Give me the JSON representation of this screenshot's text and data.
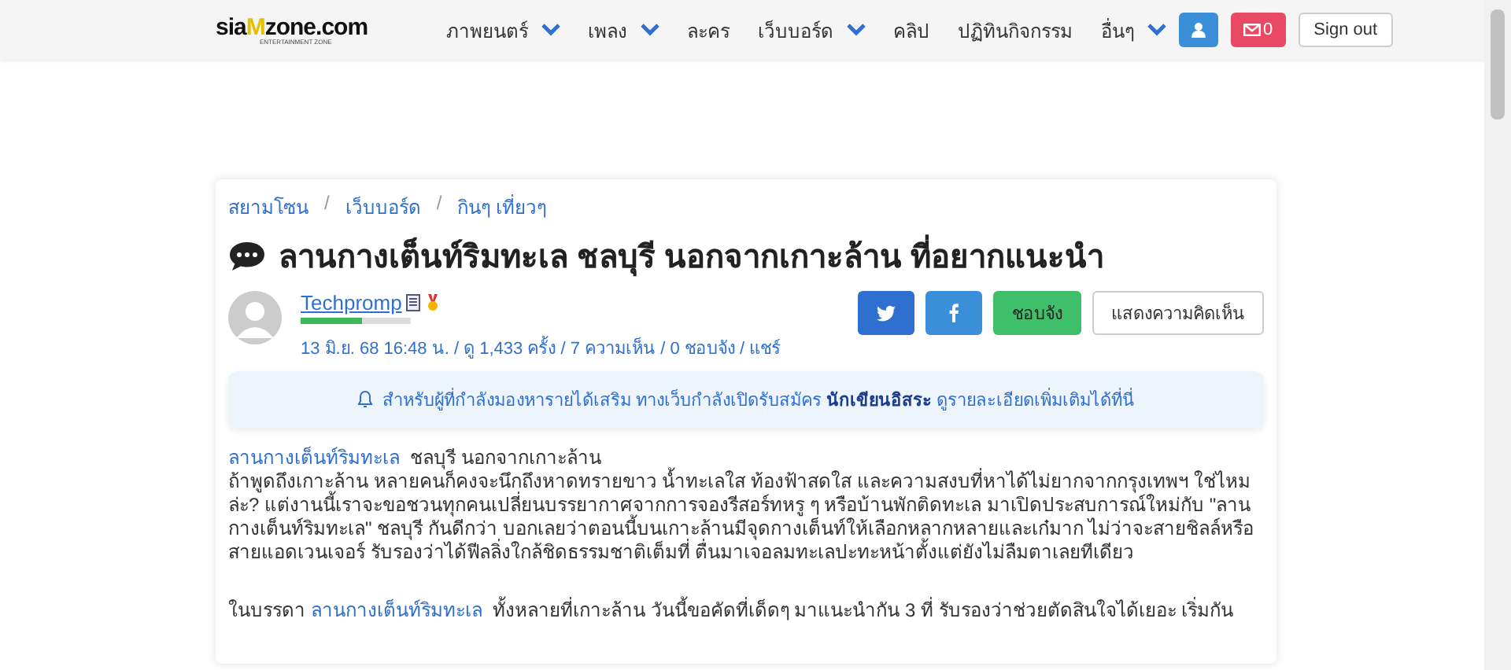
{
  "nav": {
    "logo": {
      "pre": "sia",
      "mark": "M",
      "post": "zone.com",
      "tagline": "ENTERTAINMENT ZONE"
    },
    "items": [
      {
        "label": "ภาพยนตร์",
        "dropdown": true
      },
      {
        "label": "เพลง",
        "dropdown": true
      },
      {
        "label": "ละคร",
        "dropdown": false
      },
      {
        "label": "เว็บบอร์ด",
        "dropdown": true
      },
      {
        "label": "คลิป",
        "dropdown": false
      },
      {
        "label": "ปฏิทินกิจกรรม",
        "dropdown": false
      },
      {
        "label": "อื่นๆ",
        "dropdown": true
      }
    ],
    "mail_count": "0",
    "signout": "Sign out"
  },
  "breadcrumb": [
    "สยามโซน",
    "เว็บบอร์ด",
    "กินๆ เที่ยวๆ"
  ],
  "breadcrumb_separator": "/",
  "title": "ลานกางเต็นท์ริมทะเล ชลบุรี นอกจากเกาะล้าน ที่อยากแนะนำ",
  "author": {
    "name": "Techpromp",
    "level": 0.55
  },
  "buttons": {
    "like": "ชอบจัง",
    "comments": "แสดงความคิดเห็น"
  },
  "meta": "13 มิ.ย. 68 16:48 น. / ดู 1,433 ครั้ง / 7 ความเห็น / 0 ชอบจัง / แชร์",
  "notice": "สำหรับผู้ที่กำลังมองหารายได้เสริม ทางเว็บกำลังเปิดรับสมัคร **นักเขียนอิสระ** ดูรายละเอียดเพิ่มเติมได้ที่นี่",
  "paragraphs": [
    [
      {
        "text": "ลานกางเต็นท์ริมทะเล",
        "link": true
      },
      {
        "text": "  ชลบุรี นอกจากเกาะล้าน\nถ้าพูดถึงเกาะล้าน หลายคนก็คงจะนึกถึงหาดทรายขาว น้ำทะเลใส ท้องฟ้าสดใส และความสงบที่หาได้ไม่ยากจากกรุงเทพฯ ใช่ไหมล่ะ? แต่งานนี้เราจะขอชวนทุกคนเปลี่ยนบรรยากาศจากการจองรีสอร์ทหรู ๆ หรือบ้านพักติดทะเล มาเปิดประสบการณ์ใหม่กับ \"ลานกางเต็นท์ริมทะเล\" ชลบุรี กันดีกว่า บอกเลยว่าตอนนี้บนเกาะล้านมีจุดกางเต็นท์ให้เลือกหลากหลายและเก๋มาก ไม่ว่าจะสายชิลล์หรือสายแอดเวนเจอร์ รับรองว่าได้ฟีลลิ่งใกล้ชิดธรรมชาติเต็มที่ ตื่นมาเจอลมทะเลปะทะหน้าตั้งแต่ยังไม่ลืมตาเลยทีเดียว",
        "link": false
      }
    ],
    [
      {
        "text": "ในบรรดา ",
        "link": false
      },
      {
        "text": "ลานกางเต็นท์ริมทะเล",
        "link": true
      },
      {
        "text": "  ทั้งหลายที่เกาะล้าน วันนี้ขอคัดที่เด็ดๆ มาแนะนำกัน 3 ที่ รับรองว่าช่วยตัดสินใจได้เยอะ เริ่มกัน",
        "link": false
      }
    ]
  ]
}
